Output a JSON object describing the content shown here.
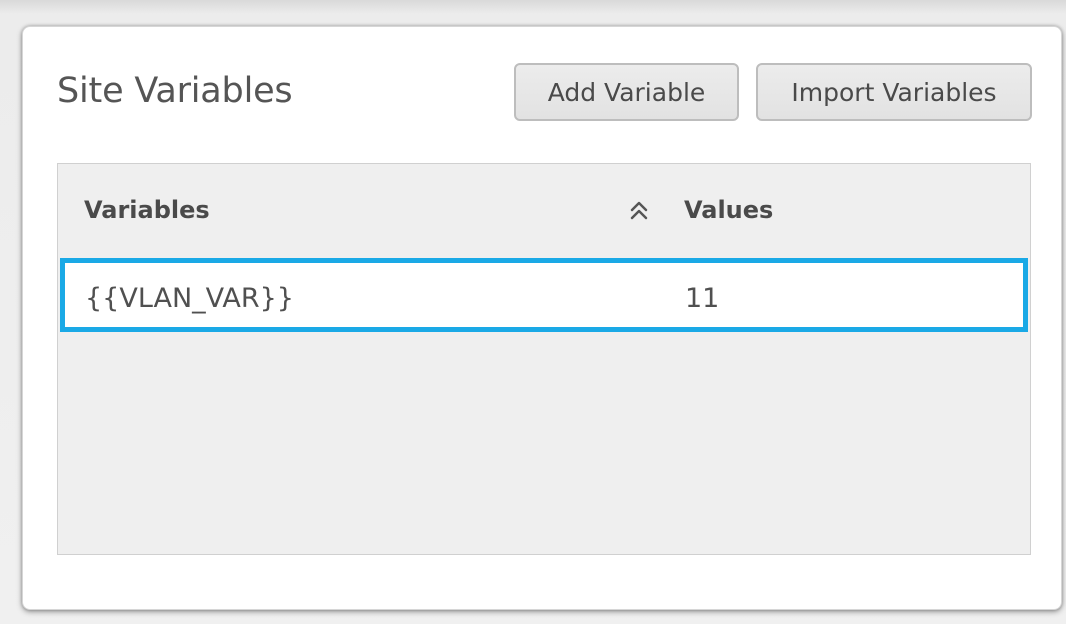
{
  "panel": {
    "title": "Site Variables",
    "buttons": {
      "add_label": "Add Variable",
      "import_label": "Import Variables"
    }
  },
  "table": {
    "columns": {
      "variables": "Variables",
      "values": "Values"
    },
    "sort_icon": "double-chevron-up-icon",
    "rows": [
      {
        "variable": "{{VLAN_VAR}}",
        "value": "11",
        "selected": true
      }
    ]
  },
  "colors": {
    "selected_row_border": "#1aa9e6",
    "button_bg": "#e6e6e6",
    "table_bg": "#efefef"
  }
}
